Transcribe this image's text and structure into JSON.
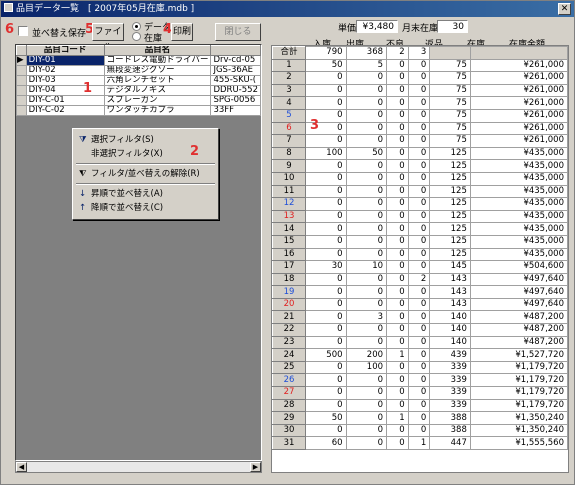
{
  "window": {
    "title": "品目データ一覧　[ 2007年05月在庫.mdb ]",
    "close": "✕"
  },
  "toolbar": {
    "save_sort": "並べ替え保存",
    "file": "ファイル",
    "radio_data": "データ",
    "radio_stock": "在庫",
    "print": "印刷",
    "close": "閉じる"
  },
  "markers": {
    "m6": "6",
    "m5": "5",
    "m4": "4",
    "m1": "1",
    "m2": "2",
    "m3": "3"
  },
  "summary": {
    "unit_price_label": "単価",
    "unit_price": "¥3,480",
    "month_end_label": "月末在庫",
    "month_end": "30"
  },
  "left_table": {
    "headers": [
      "品目コード",
      "品目名",
      ""
    ],
    "rows": [
      {
        "code": "DIY-01",
        "name": "コードレス電動ドライバー",
        "extra": "Drv-cd-05"
      },
      {
        "code": "DIY-02",
        "name": "無段変速ジグソー",
        "extra": "JGS-36AE"
      },
      {
        "code": "DIY-03",
        "name": "六角レンチセット",
        "extra": "455-SKU-("
      },
      {
        "code": "DIY-04",
        "name": "デジタルノギス",
        "extra": "DDRU-552"
      },
      {
        "code": "DIY-C-01",
        "name": "スプレーガン",
        "extra": "SPG-0056"
      },
      {
        "code": "DIY-C-02",
        "name": "ワンタッチカプラ",
        "extra": "33FF"
      }
    ]
  },
  "context_menu": {
    "items": [
      "選択フィルタ(S)",
      "非選択フィルタ(X)",
      "フィルタ/並べ替えの解除(R)",
      "昇順で並べ替え(A)",
      "降順で並べ替え(C)"
    ]
  },
  "right_table": {
    "headers": [
      "入庫",
      "出庫",
      "不良",
      "返品",
      "在庫",
      "在庫金額"
    ],
    "total": {
      "label": "合計",
      "in": "790",
      "out": "368",
      "bad": "2",
      "ret": "3"
    },
    "rows": [
      [
        "1",
        "50",
        "5",
        "0",
        "0",
        "75",
        "¥261,000"
      ],
      [
        "2",
        "0",
        "0",
        "0",
        "0",
        "75",
        "¥261,000"
      ],
      [
        "3",
        "0",
        "0",
        "0",
        "0",
        "75",
        "¥261,000"
      ],
      [
        "4",
        "0",
        "0",
        "0",
        "0",
        "75",
        "¥261,000"
      ],
      [
        "5",
        "0",
        "0",
        "0",
        "0",
        "75",
        "¥261,000"
      ],
      [
        "6",
        "0",
        "0",
        "0",
        "0",
        "75",
        "¥261,000"
      ],
      [
        "7",
        "0",
        "0",
        "0",
        "0",
        "75",
        "¥261,000"
      ],
      [
        "8",
        "100",
        "50",
        "0",
        "0",
        "125",
        "¥435,000"
      ],
      [
        "9",
        "0",
        "0",
        "0",
        "0",
        "125",
        "¥435,000"
      ],
      [
        "10",
        "0",
        "0",
        "0",
        "0",
        "125",
        "¥435,000"
      ],
      [
        "11",
        "0",
        "0",
        "0",
        "0",
        "125",
        "¥435,000"
      ],
      [
        "12",
        "0",
        "0",
        "0",
        "0",
        "125",
        "¥435,000"
      ],
      [
        "13",
        "0",
        "0",
        "0",
        "0",
        "125",
        "¥435,000"
      ],
      [
        "14",
        "0",
        "0",
        "0",
        "0",
        "125",
        "¥435,000"
      ],
      [
        "15",
        "0",
        "0",
        "0",
        "0",
        "125",
        "¥435,000"
      ],
      [
        "16",
        "0",
        "0",
        "0",
        "0",
        "125",
        "¥435,000"
      ],
      [
        "17",
        "30",
        "10",
        "0",
        "0",
        "145",
        "¥504,600"
      ],
      [
        "18",
        "0",
        "0",
        "0",
        "2",
        "143",
        "¥497,640"
      ],
      [
        "19",
        "0",
        "0",
        "0",
        "0",
        "143",
        "¥497,640"
      ],
      [
        "20",
        "0",
        "0",
        "0",
        "0",
        "143",
        "¥497,640"
      ],
      [
        "21",
        "0",
        "3",
        "0",
        "0",
        "140",
        "¥487,200"
      ],
      [
        "22",
        "0",
        "0",
        "0",
        "0",
        "140",
        "¥487,200"
      ],
      [
        "23",
        "0",
        "0",
        "0",
        "0",
        "140",
        "¥487,200"
      ],
      [
        "24",
        "500",
        "200",
        "1",
        "0",
        "439",
        "¥1,527,720"
      ],
      [
        "25",
        "0",
        "100",
        "0",
        "0",
        "339",
        "¥1,179,720"
      ],
      [
        "26",
        "0",
        "0",
        "0",
        "0",
        "339",
        "¥1,179,720"
      ],
      [
        "27",
        "0",
        "0",
        "0",
        "0",
        "339",
        "¥1,179,720"
      ],
      [
        "28",
        "0",
        "0",
        "0",
        "0",
        "339",
        "¥1,179,720"
      ],
      [
        "29",
        "50",
        "0",
        "1",
        "0",
        "388",
        "¥1,350,240"
      ],
      [
        "30",
        "0",
        "0",
        "0",
        "0",
        "388",
        "¥1,350,240"
      ],
      [
        "31",
        "60",
        "0",
        "0",
        "1",
        "447",
        "¥1,555,560"
      ]
    ]
  },
  "colors": {
    "weekend_blue": "#1f4fd8",
    "weekend_red": "#e02020",
    "marker": "#e03030"
  }
}
